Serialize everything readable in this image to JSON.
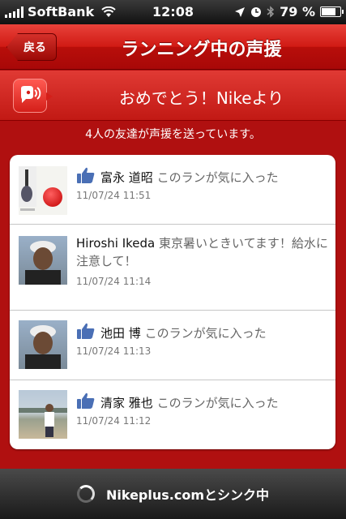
{
  "status_bar": {
    "carrier": "SoftBank",
    "time": "12:08",
    "battery": "79 %",
    "battery_level": 0.79
  },
  "nav": {
    "back_label": "戻る",
    "title": "ランニング中の声援"
  },
  "banner": {
    "text": "おめでとう！Nikeより",
    "icon": "cheer-speech-icon"
  },
  "subtitle": "4人の友達が声援を送っています。",
  "cheers": [
    {
      "name": "富永 道昭",
      "message": "このランが気に入った",
      "date": "11/07/24  11:51",
      "icon": "like-icon"
    },
    {
      "name": "Hiroshi Ikeda",
      "message": "東京暑いときいてます！給水に注意して！",
      "date": "11/07/24  11:14"
    },
    {
      "name": "池田 博",
      "message": "このランが気に入った",
      "date": "11/07/24  11:13",
      "icon": "like-icon"
    },
    {
      "name": "清家 雅也",
      "message": "このランが気に入った",
      "date": "11/07/24  11:12",
      "icon": "like-icon"
    }
  ],
  "sync": {
    "text": "Nikeplus.comとシンク中"
  },
  "colors": {
    "accent": "#c8140f",
    "like_blue": "#4a6fb5"
  }
}
